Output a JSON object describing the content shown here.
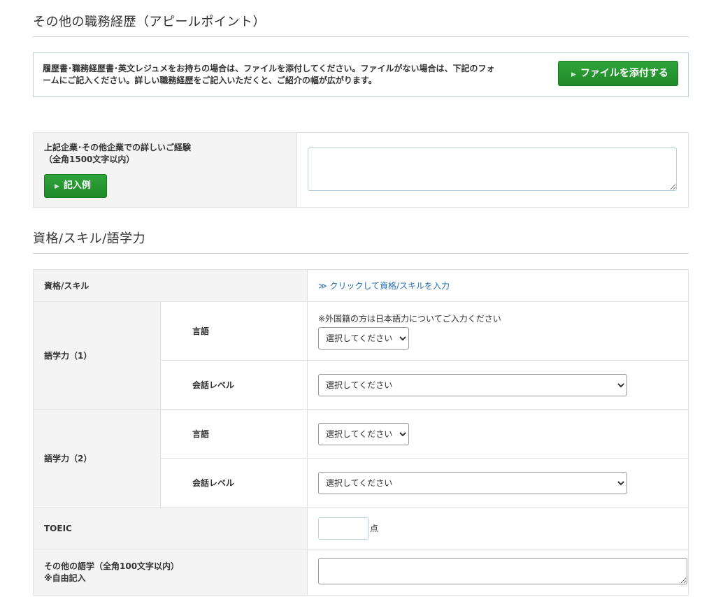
{
  "section1": {
    "title": "その他の職務経歴（アピールポイント）",
    "notice_line1": "履歴書･職務経歴書･英文レジュメをお持ちの場合は、ファイルを添付してください。ファイルがない場合は、下記のフォ",
    "notice_line2": "ームにご記入ください。詳しい職務経歴をご記入いただくと、ご紹介の幅が広がります。",
    "attach_button": "ファイルを添付する",
    "experience_label_1": "上記企業･その他企業での詳しいご経験",
    "experience_label_2": "（全角1500文字以内）",
    "example_button": "記入例",
    "experience_value": ""
  },
  "section2": {
    "title": "資格/スキル/語学力",
    "skills_label": "資格/スキル",
    "skills_link": "≫ クリックして資格/スキルを入力",
    "lang1_label": "語学力（1）",
    "lang2_label": "語学力（2）",
    "language_label": "言語",
    "level_label": "会話レベル",
    "foreign_note": "※外国籍の方は日本語力についてご入力ください",
    "select_placeholder": "選択してください",
    "lang1_language_value": "選択してください",
    "lang1_level_value": "選択してください",
    "lang2_language_value": "選択してください",
    "lang2_level_value": "選択してください",
    "toeic_label": "TOEIC",
    "toeic_value": "",
    "toeic_unit": "点",
    "other_lang_label_1": "その他の語学（全角100文字以内）",
    "other_lang_label_2": "※自由記入",
    "other_lang_value": ""
  },
  "colors": {
    "accent_green": "#1e8a28",
    "link_blue": "#2a6eb3",
    "label_bg": "#f4f4f4",
    "border": "#e2e2e2"
  }
}
